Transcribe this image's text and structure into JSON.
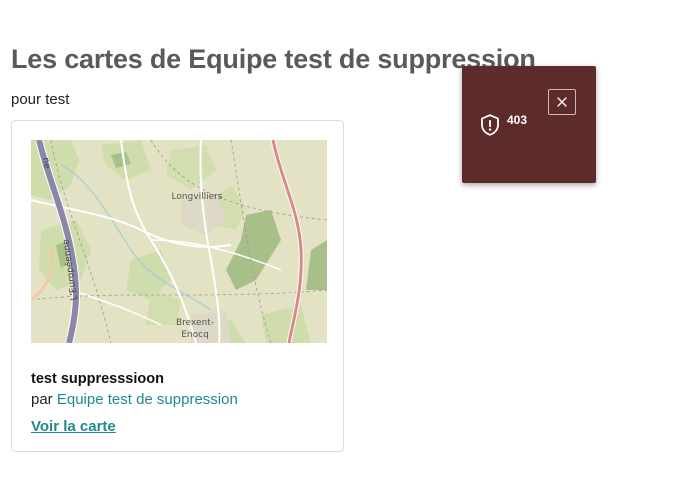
{
  "page": {
    "title": "Les cartes de Equipe test de suppression",
    "subtitle": "pour test"
  },
  "cards": [
    {
      "title": "test suppresssioon",
      "by_prefix": "par ",
      "team_link": "Equipe test de suppression",
      "view_link": "Voir la carte",
      "map_labels": {
        "town1": "Longvilliers",
        "town2a": "Brexent-",
        "town2b": "Enocq",
        "road": "L'Européenne",
        "road_edge": "ne"
      }
    }
  ],
  "toast": {
    "message": "403",
    "icon": "alert-shield-icon",
    "close_icon": "close-icon"
  },
  "colors": {
    "title": "#5a5a5a",
    "link": "#1e8a8f",
    "toast_bg": "#5e2b2b"
  }
}
